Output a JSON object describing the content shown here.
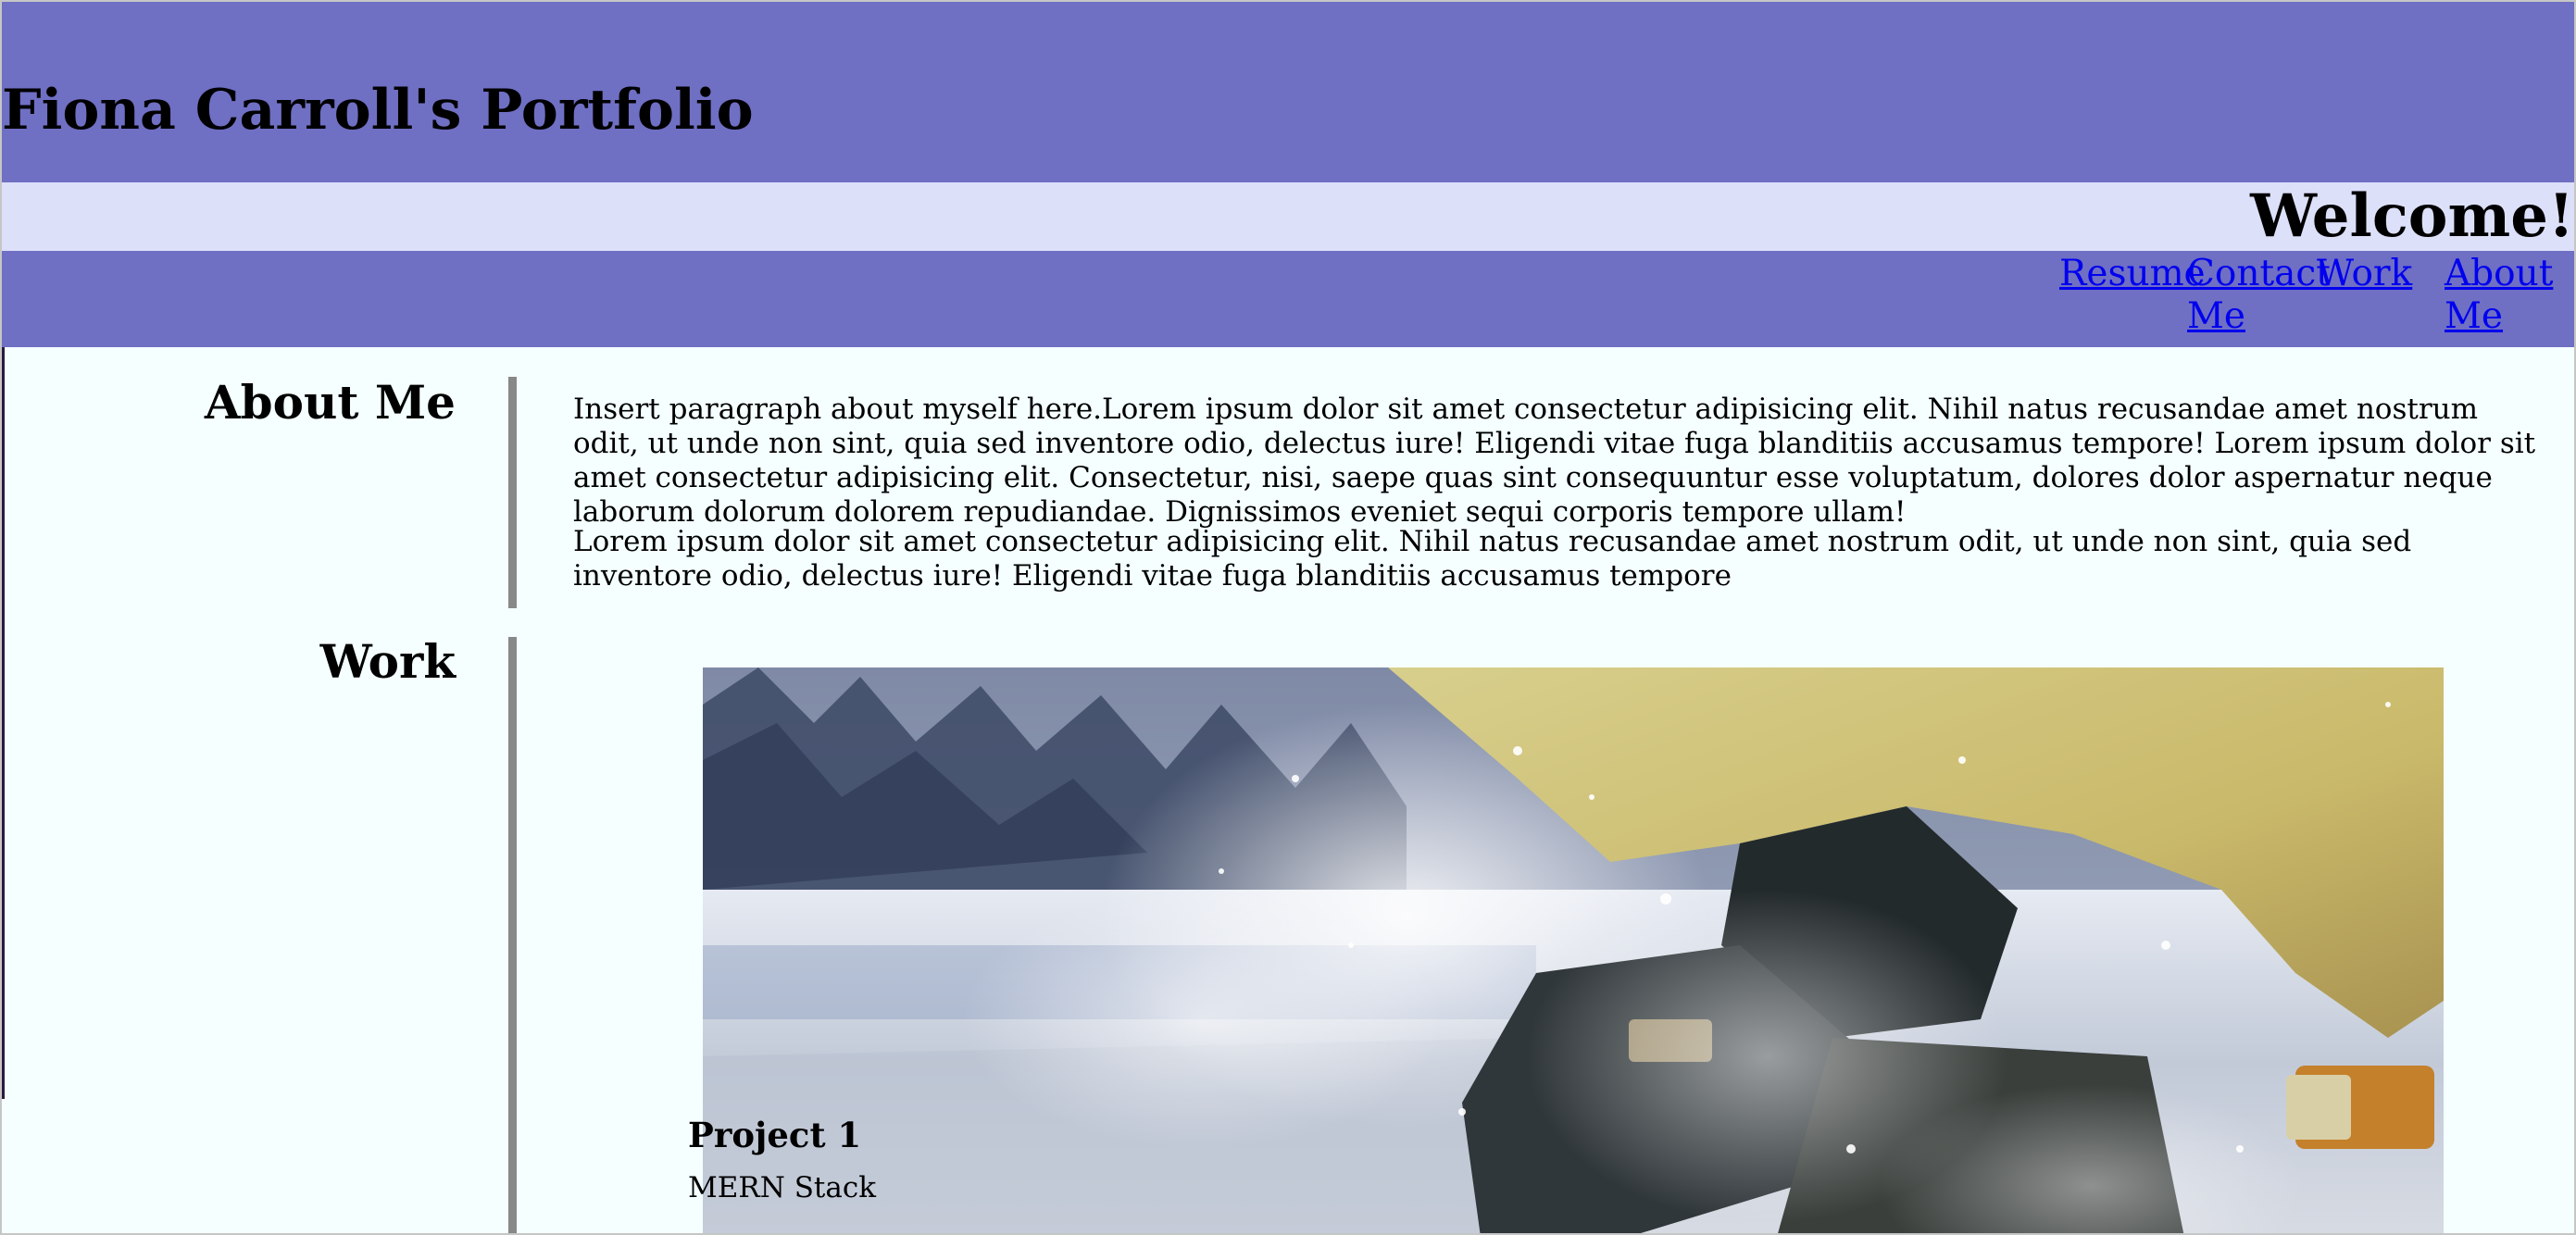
{
  "header": {
    "title": "Fiona Carroll's Portfolio",
    "welcome": "Welcome!"
  },
  "nav": {
    "items": [
      {
        "label": "Resume"
      },
      {
        "label": "Contact Me"
      },
      {
        "label": "Work"
      },
      {
        "label": "About Me"
      }
    ]
  },
  "about": {
    "heading": "About Me",
    "paragraphs": [
      "Insert paragraph about myself here.Lorem ipsum dolor sit amet consectetur adipisicing elit. Nihil natus recusandae amet nostrum odit, ut unde non sint, quia sed inventore odio, delectus iure! Eligendi vitae fuga blanditiis accusamus tempore! Lorem ipsum dolor sit amet consectetur adipisicing elit. Consectetur, nisi, saepe quas sint consequuntur esse voluptatum, dolores dolor aspernatur neque laborum dolorum dolorem repudiandae. Dignissimos eveniet sequi corporis tempore ullam!",
      "Lorem ipsum dolor sit amet consectetur adipisicing elit. Nihil natus recusandae amet nostrum odit, ut unde non sint, quia sed inventore odio, delectus iure! Eligendi vitae fuga blanditiis accusamus tempore"
    ]
  },
  "work": {
    "heading": "Work",
    "projects": [
      {
        "title": "Project 1",
        "subtitle": "MERN Stack"
      }
    ]
  },
  "colors": {
    "header_bg": "#6f6fc4",
    "welcome_bg": "#dce0f9",
    "page_bg": "#f5ffff",
    "link": "#0000ee",
    "divider": "#888888"
  }
}
